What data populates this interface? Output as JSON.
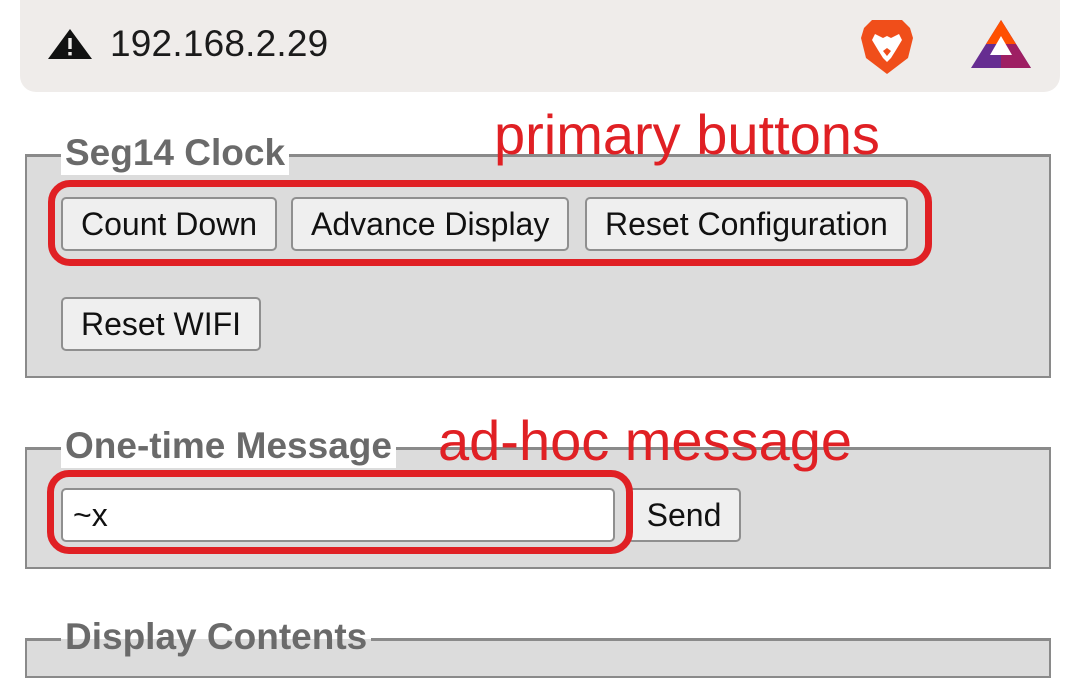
{
  "browser": {
    "url": "192.168.2.29",
    "security_icon": "warning-triangle-icon",
    "extension_icons": [
      "brave-lion-icon",
      "bat-triangle-icon"
    ]
  },
  "clock_section": {
    "legend": "Seg14 Clock",
    "buttons": [
      {
        "label": "Count Down"
      },
      {
        "label": "Advance Display"
      },
      {
        "label": "Reset Configuration"
      },
      {
        "label": "Reset WIFI"
      }
    ]
  },
  "message_section": {
    "legend": "One-time Message",
    "input_value": "~x",
    "send_label": "Send"
  },
  "display_section": {
    "legend": "Display Contents"
  },
  "annotations": {
    "primary_label": "primary buttons",
    "adhoc_label": "ad-hoc message",
    "color": "#e02024"
  }
}
